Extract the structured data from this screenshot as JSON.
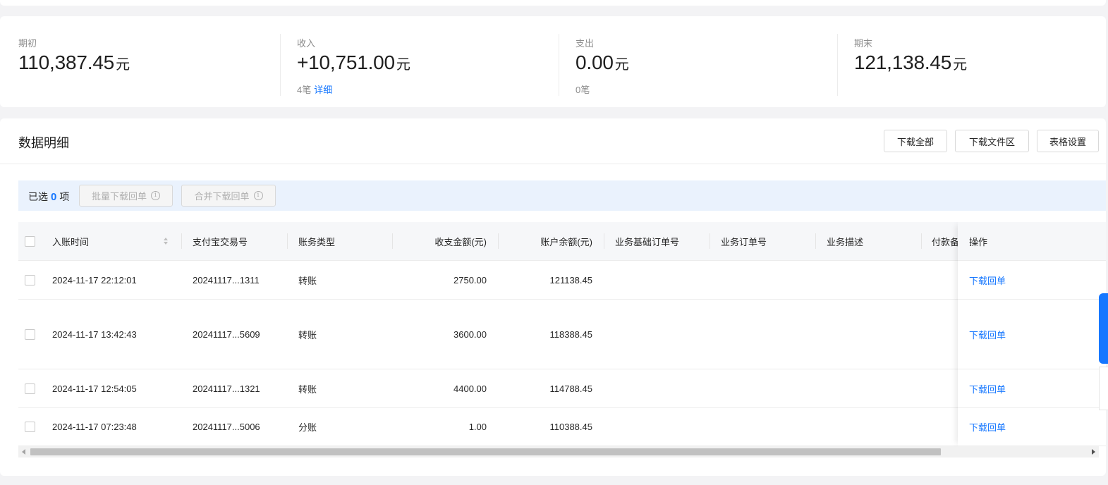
{
  "summary": {
    "opening": {
      "label": "期初",
      "value": "110,387.45",
      "unit": "元"
    },
    "income": {
      "label": "收入",
      "value": "+10,751.00",
      "unit": "元",
      "count": "4笔",
      "link": "详细"
    },
    "expense": {
      "label": "支出",
      "value": "0.00",
      "unit": "元",
      "count": "0笔"
    },
    "closing": {
      "label": "期末",
      "value": "121,138.45",
      "unit": "元"
    }
  },
  "detail": {
    "title": "数据明细",
    "buttons": {
      "download_all": "下载全部",
      "download_area": "下载文件区",
      "table_settings": "表格设置"
    }
  },
  "selection": {
    "prefix": "已选",
    "count": "0",
    "suffix": "项",
    "batch_download": "批量下载回单",
    "merge_download": "合并下载回单",
    "info_glyph": "i"
  },
  "table": {
    "columns": {
      "time": "入账时间",
      "trade_no": "支付宝交易号",
      "type": "账务类型",
      "amount": "收支金额(元)",
      "balance": "账户余额(元)",
      "base_order": "业务基础订单号",
      "order": "业务订单号",
      "desc": "业务描述",
      "payer": "付款备",
      "op": "操作"
    },
    "rows": [
      {
        "time": "2024-11-17 22:12:01",
        "trade_no": "20241117...1311",
        "type": "转账",
        "amount": "2750.00",
        "balance": "121138.45",
        "op": "下载回单"
      },
      {
        "time": "2024-11-17 13:42:43",
        "trade_no": "20241117...5609",
        "type": "转账",
        "amount": "3600.00",
        "balance": "118388.45",
        "op": "下载回单"
      },
      {
        "time": "2024-11-17 12:54:05",
        "trade_no": "20241117...1321",
        "type": "转账",
        "amount": "4400.00",
        "balance": "114788.45",
        "op": "下载回单"
      },
      {
        "time": "2024-11-17 07:23:48",
        "trade_no": "20241117...5006",
        "type": "分账",
        "amount": "1.00",
        "balance": "110388.45",
        "op": "下载回单"
      }
    ]
  },
  "icons": {
    "sort": "sort-icon",
    "info": "info-icon",
    "scroll_left": "arrow-left-icon",
    "scroll_right": "arrow-right-icon"
  },
  "colors": {
    "accent": "#1677ff",
    "selection_bg": "#eaf2fd",
    "page_bg": "#f3f3f5"
  }
}
